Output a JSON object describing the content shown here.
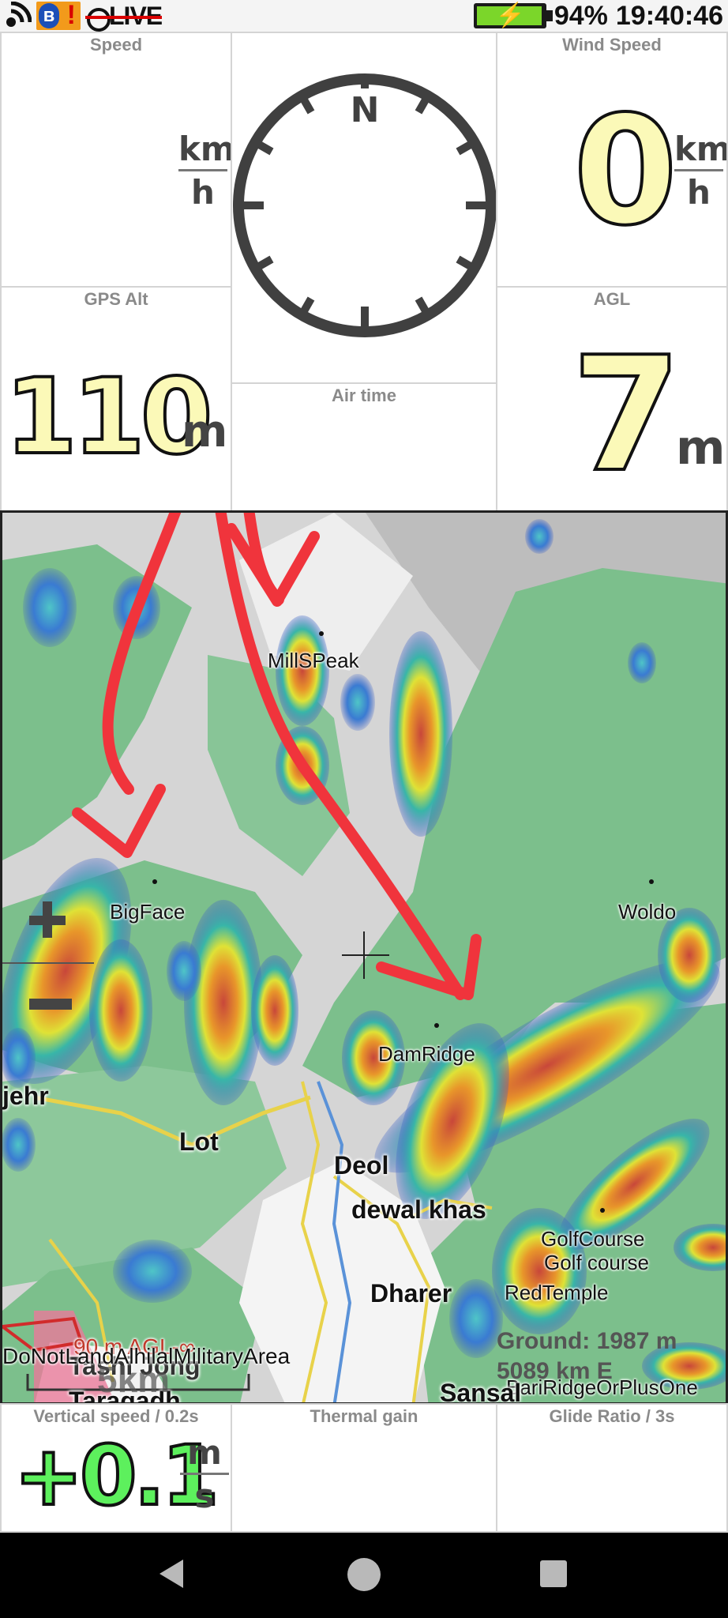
{
  "status_bar": {
    "live_label": "LIVE",
    "battery_text": "94%",
    "time": "19:40:46",
    "icons": [
      "signal-icon",
      "bluetooth-icon",
      "warning-icon",
      "live-icon",
      "battery-icon"
    ],
    "battery_level": 0.94
  },
  "panels": {
    "speed": {
      "title": "Speed",
      "unit_top": "km",
      "unit_bottom": "h"
    },
    "wind_speed": {
      "title": "Wind Speed",
      "value": "0",
      "unit_top": "km",
      "unit_bottom": "h"
    },
    "compass": {
      "north_label": "N"
    },
    "gps_alt": {
      "title": "GPS Alt",
      "value": "110",
      "unit": "m"
    },
    "agl": {
      "title": "AGL",
      "value": "7",
      "unit": "m"
    },
    "air_time": {
      "title": "Air time"
    },
    "vertical_speed": {
      "title": "Vertical speed / 0.2s",
      "value": "+0.1",
      "unit_top": "m",
      "unit_bottom": "s"
    },
    "thermal_gain": {
      "title": "Thermal gain"
    },
    "glide_ratio": {
      "title": "Glide Ratio / 3s"
    }
  },
  "map": {
    "waypoints": [
      "MillSPeak",
      "BigFace",
      "Woldo",
      "DamRidge",
      "GolfCourse",
      "RedTemple",
      "BariRidgeOrPlusOne"
    ],
    "places": [
      "jehr",
      "Lot",
      "Deol",
      "dewal khas",
      "Dharer",
      "Golf course",
      "Tashi Jong",
      "Taragadh",
      "Sansal"
    ],
    "airspace_label": "90 m AGL-∞",
    "airspace_name": "DoNotLandAlhilalMilitaryArea",
    "scale_label": "5km",
    "ground_info": "Ground: 1987 m",
    "distance_info": "5089 km E",
    "controls": [
      "zoom-in-button",
      "zoom-out-button"
    ],
    "colors": {
      "terrain_green": "#7cbf8c",
      "annotation_red": "#f0343c"
    }
  },
  "nav_bar": {
    "icons": [
      "back-icon",
      "home-icon",
      "recents-icon"
    ]
  }
}
